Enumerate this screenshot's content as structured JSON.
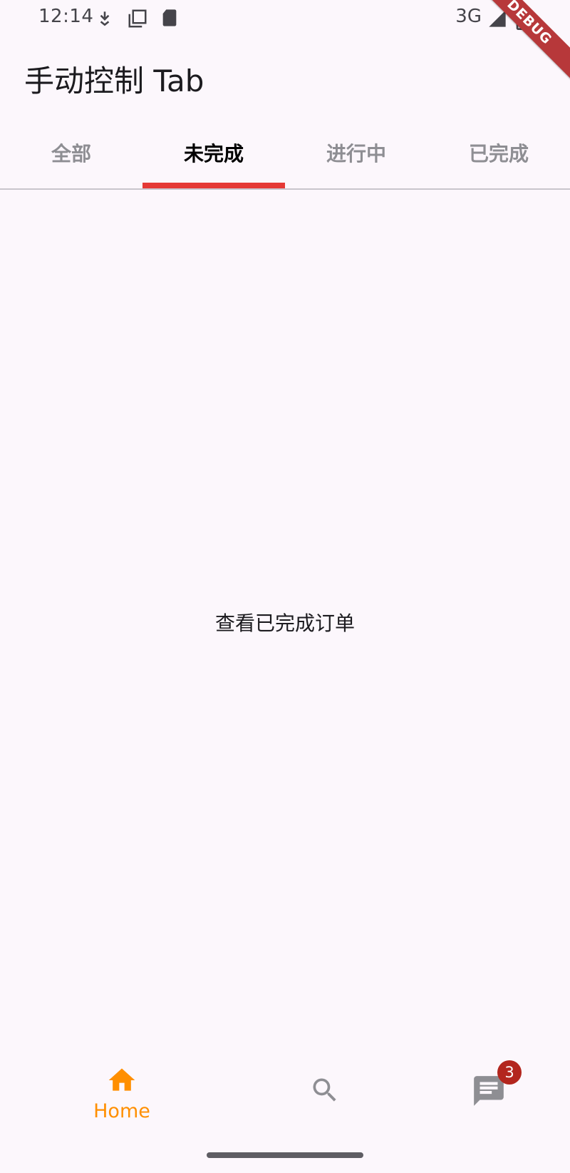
{
  "status_bar": {
    "time": "12:14",
    "network": "3G",
    "icons": [
      "download-notification-icon",
      "screenshot-icon",
      "sd-card-icon",
      "signal-icon",
      "battery-icon"
    ]
  },
  "debug_banner": {
    "label": "DEBUG"
  },
  "app_bar": {
    "title": "手动控制 Tab"
  },
  "tabs": [
    {
      "label": "全部",
      "selected": false
    },
    {
      "label": "未完成",
      "selected": true
    },
    {
      "label": "进行中",
      "selected": false
    },
    {
      "label": "已完成",
      "selected": false
    }
  ],
  "content": {
    "text": "查看已完成订单"
  },
  "bottom_nav": {
    "home_label": "Home",
    "messages_badge": "3",
    "items": [
      "home-icon",
      "search-icon",
      "messages-icon"
    ]
  },
  "colors": {
    "accent": "#e53935",
    "home_active": "#ff8f00",
    "badge": "#b3261e",
    "background": "#fcf7fc"
  }
}
